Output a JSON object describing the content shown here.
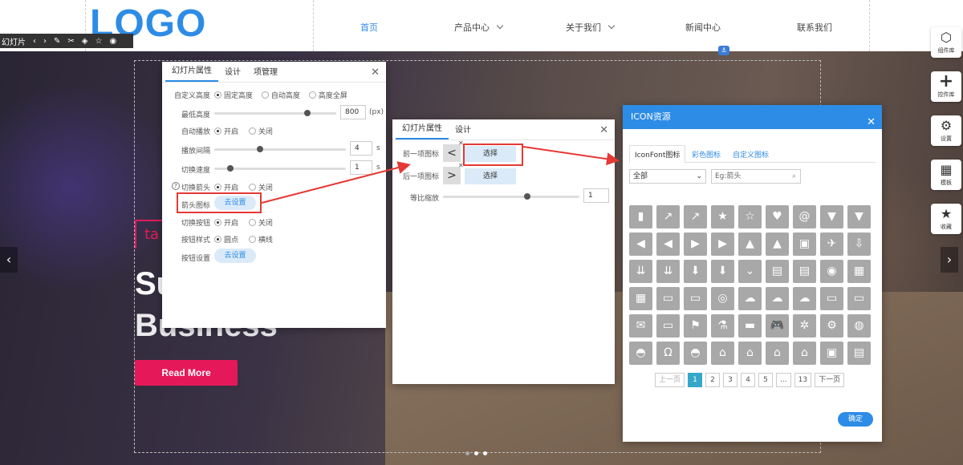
{
  "header": {
    "logo": "LOGO",
    "nav": [
      {
        "label": "首页",
        "active": true,
        "dropdown": false
      },
      {
        "label": "产品中心",
        "active": false,
        "dropdown": true
      },
      {
        "label": "关于我们",
        "active": false,
        "dropdown": true
      },
      {
        "label": "新闻中心",
        "active": false,
        "dropdown": false
      },
      {
        "label": "联系我们",
        "active": false,
        "dropdown": false
      }
    ]
  },
  "slide_toolbar": {
    "label": "幻灯片"
  },
  "hero": {
    "tag": "ta",
    "line1": "Su",
    "line2": "Business",
    "button": "Read More"
  },
  "right_tools": [
    {
      "label": "组件库",
      "icon": "cube-icon"
    },
    {
      "label": "控件库",
      "icon": "plus-icon"
    },
    {
      "label": "设置",
      "icon": "gear-icon"
    },
    {
      "label": "模板",
      "icon": "grid-icon"
    },
    {
      "label": "收藏",
      "icon": "star-icon"
    }
  ],
  "panel1": {
    "tabs": [
      "幻灯片属性",
      "设计",
      "项管理"
    ],
    "custom_height": {
      "label": "自定义高度",
      "options": [
        "固定高度",
        "自动高度",
        "高度全屏"
      ],
      "selected": 0
    },
    "min_height": {
      "label": "最低高度",
      "value": "800",
      "unit": "(px)",
      "slider": 0.9
    },
    "autoplay": {
      "label": "自动播放",
      "options": [
        "开启",
        "关闭"
      ],
      "selected": 0
    },
    "interval": {
      "label": "播放间隔",
      "value": "4",
      "unit": "s",
      "slider": 0.35
    },
    "speed": {
      "label": "切换速度",
      "value": "1",
      "unit": "s",
      "slider": 0.12
    },
    "arrows": {
      "label": "切换箭头",
      "options": [
        "开启",
        "关闭"
      ],
      "selected": 0
    },
    "arrow_icon": {
      "label": "箭头图标",
      "button": "去设置"
    },
    "switch_btn": {
      "label": "切换按钮",
      "options": [
        "开启",
        "关闭"
      ],
      "selected": 0
    },
    "btn_style": {
      "label": "按钮样式",
      "options": [
        "圆点",
        "横线"
      ],
      "selected": 0
    },
    "btn_setting": {
      "label": "按钮设置",
      "button": "去设置"
    }
  },
  "panel2": {
    "tabs": [
      "幻灯片属性",
      "设计"
    ],
    "prev": {
      "label": "前一项图标",
      "arrow": "<",
      "button": "选择"
    },
    "next": {
      "label": "后一项图标",
      "arrow": ">",
      "button": "选择"
    },
    "scale": {
      "label": "等比缩放",
      "value": "1",
      "slider": 0.62
    }
  },
  "panel3": {
    "title": "ICON资源",
    "tabs": [
      "IconFont图标",
      "彩色图标",
      "自定义图标"
    ],
    "filter": "全部",
    "search_placeholder": "Eg:箭头",
    "icons": [
      "▮",
      "↗",
      "↗",
      "★",
      "☆",
      "♥",
      "@",
      "▼",
      "▼",
      "◀",
      "◀",
      "▶",
      "▶",
      "▲",
      "▲",
      "▣",
      "✈",
      "⇩",
      "⇊",
      "⇊",
      "⬇",
      "⬇",
      "⌄",
      "▤",
      "▤",
      "◉",
      "▦",
      "▦",
      "▭",
      "▭",
      "◎",
      "☁",
      "☁",
      "☁",
      "▭",
      "▭",
      "✉",
      "▭",
      "⚑",
      "⚗",
      "▬",
      "🎮",
      "✲",
      "⚙",
      "◍",
      "◓",
      "Ω",
      "◓",
      "⌂",
      "⌂",
      "⌂",
      "⌂",
      "▣",
      "▤"
    ],
    "pagination": [
      "上一页",
      "1",
      "2",
      "3",
      "4",
      "5",
      "...",
      "13",
      "下一页"
    ],
    "current_page": "1",
    "ok": "确定"
  }
}
